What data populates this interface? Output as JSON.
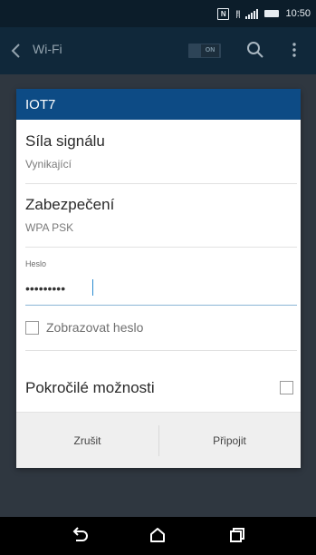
{
  "status_bar": {
    "time": "10:50",
    "nfc_icon": "N",
    "extra_icon": "|!|"
  },
  "app_bar": {
    "title": "Wi-Fi",
    "toggle_label": "ON",
    "icons": [
      "back-chevron-icon",
      "search-icon",
      "more-vert-icon"
    ]
  },
  "dialog": {
    "title": "IOT7",
    "signal": {
      "label": "Síla signálu",
      "value": "Vynikající"
    },
    "security": {
      "label": "Zabezpečení",
      "value": "WPA PSK"
    },
    "password": {
      "label": "Heslo",
      "value": "•••••••••"
    },
    "show_password_label": "Zobrazovat heslo",
    "advanced_label": "Pokročilé možnosti",
    "cancel_label": "Zrušit",
    "connect_label": "Připojit"
  },
  "nav_bar": {
    "icons": [
      "back-icon",
      "home-icon",
      "recents-icon"
    ]
  },
  "colors": {
    "status_bar_bg": "#0c1d2a",
    "app_bar_bg": "#10283a",
    "overlay_bg": "#2f3740",
    "dialog_header_bg": "#0d4b85",
    "accent": "#2a8bd0"
  }
}
